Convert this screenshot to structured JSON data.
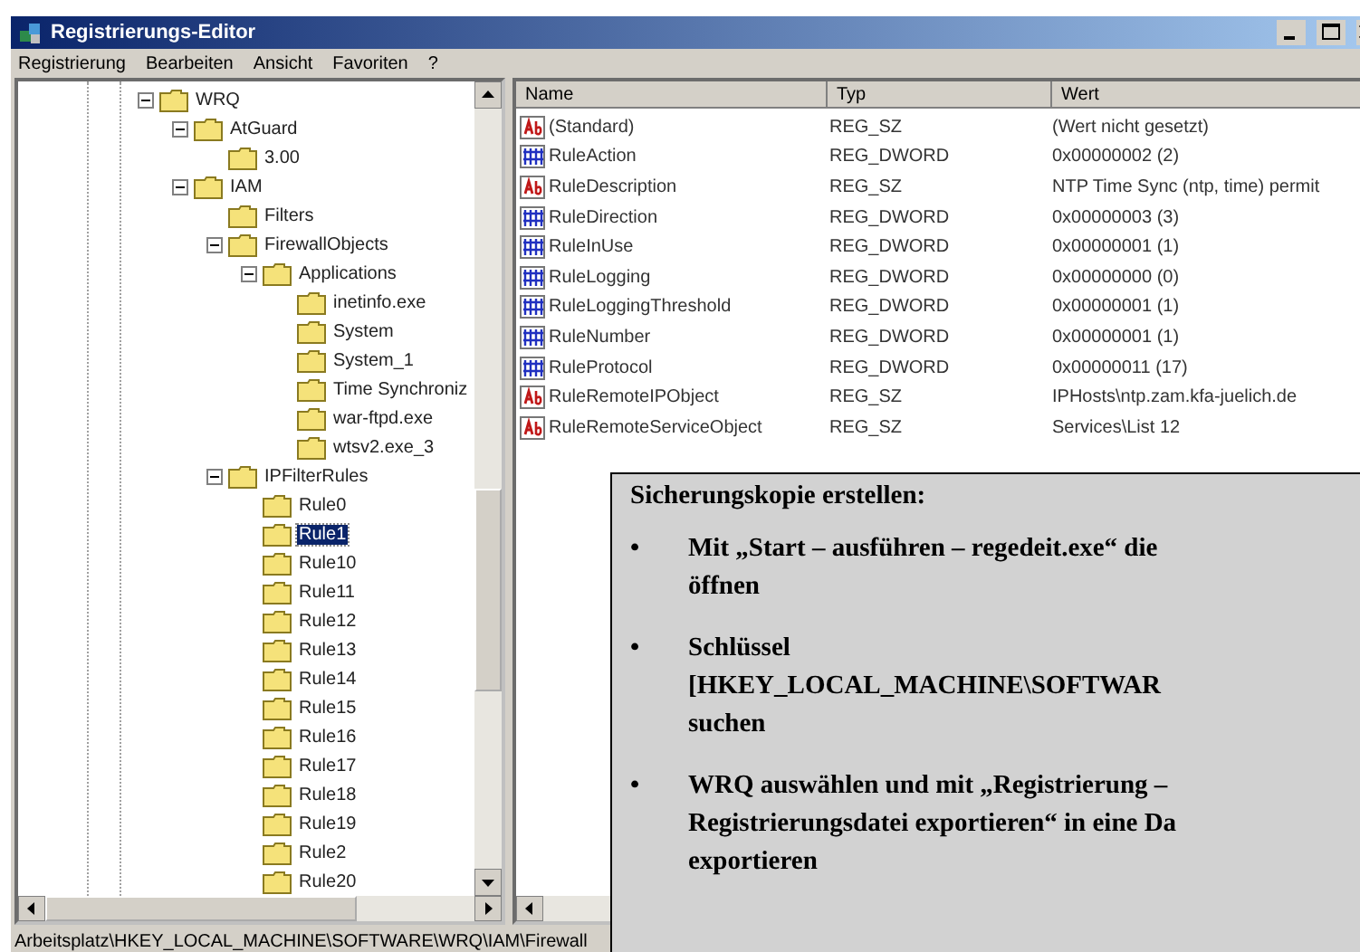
{
  "window": {
    "title": "Registrierungs-Editor"
  },
  "menu": [
    "Registrierung",
    "Bearbeiten",
    "Ansicht",
    "Favoriten",
    "?"
  ],
  "tree": [
    {
      "label": "WRQ",
      "expanded": true,
      "selected": false,
      "children": [
        {
          "label": "AtGuard",
          "expanded": true,
          "selected": false,
          "children": [
            {
              "label": "3.00",
              "selected": false
            }
          ]
        },
        {
          "label": "IAM",
          "expanded": true,
          "selected": false,
          "children": [
            {
              "label": "Filters",
              "selected": false
            },
            {
              "label": "FirewallObjects",
              "expanded": true,
              "selected": false,
              "children": [
                {
                  "label": "Applications",
                  "expanded": true,
                  "selected": false,
                  "children": [
                    {
                      "label": "inetinfo.exe",
                      "selected": false
                    },
                    {
                      "label": "System",
                      "selected": false
                    },
                    {
                      "label": "System_1",
                      "selected": false
                    },
                    {
                      "label": "Time Synchroniz",
                      "selected": false
                    },
                    {
                      "label": "war-ftpd.exe",
                      "selected": false
                    },
                    {
                      "label": "wtsv2.exe_3",
                      "selected": false
                    }
                  ]
                }
              ]
            },
            {
              "label": "IPFilterRules",
              "expanded": true,
              "selected": false,
              "children": [
                {
                  "label": "Rule0",
                  "selected": false
                },
                {
                  "label": "Rule1",
                  "selected": true
                },
                {
                  "label": "Rule10",
                  "selected": false
                },
                {
                  "label": "Rule11",
                  "selected": false
                },
                {
                  "label": "Rule12",
                  "selected": false
                },
                {
                  "label": "Rule13",
                  "selected": false
                },
                {
                  "label": "Rule14",
                  "selected": false
                },
                {
                  "label": "Rule15",
                  "selected": false
                },
                {
                  "label": "Rule16",
                  "selected": false
                },
                {
                  "label": "Rule17",
                  "selected": false
                },
                {
                  "label": "Rule18",
                  "selected": false
                },
                {
                  "label": "Rule19",
                  "selected": false
                },
                {
                  "label": "Rule2",
                  "selected": false
                },
                {
                  "label": "Rule20",
                  "selected": false
                }
              ]
            }
          ]
        }
      ]
    }
  ],
  "table": {
    "columns": [
      "Name",
      "Typ",
      "Wert"
    ],
    "rows": [
      {
        "kind": "string",
        "name": "(Standard)",
        "type": "REG_SZ",
        "value": "(Wert nicht gesetzt)"
      },
      {
        "kind": "number",
        "name": "RuleAction",
        "type": "REG_DWORD",
        "value": "0x00000002 (2)"
      },
      {
        "kind": "string",
        "name": "RuleDescription",
        "type": "REG_SZ",
        "value": "NTP Time Sync (ntp, time) permit"
      },
      {
        "kind": "number",
        "name": "RuleDirection",
        "type": "REG_DWORD",
        "value": "0x00000003 (3)"
      },
      {
        "kind": "number",
        "name": "RuleInUse",
        "type": "REG_DWORD",
        "value": "0x00000001 (1)"
      },
      {
        "kind": "number",
        "name": "RuleLogging",
        "type": "REG_DWORD",
        "value": "0x00000000 (0)"
      },
      {
        "kind": "number",
        "name": "RuleLoggingThreshold",
        "type": "REG_DWORD",
        "value": "0x00000001 (1)"
      },
      {
        "kind": "number",
        "name": "RuleNumber",
        "type": "REG_DWORD",
        "value": "0x00000001 (1)"
      },
      {
        "kind": "number",
        "name": "RuleProtocol",
        "type": "REG_DWORD",
        "value": "0x00000011 (17)"
      },
      {
        "kind": "string",
        "name": "RuleRemoteIPObject",
        "type": "REG_SZ",
        "value": "IPHosts\\ntp.zam.kfa-juelich.de"
      },
      {
        "kind": "string",
        "name": "RuleRemoteServiceObject",
        "type": "REG_SZ",
        "value": "Services\\List 12"
      }
    ]
  },
  "status_bar": "Arbeitsplatz\\HKEY_LOCAL_MACHINE\\SOFTWARE\\WRQ\\IAM\\Firewall",
  "note": {
    "title": "Sicherungskopie erstellen:",
    "bullets": [
      {
        "marker": "•",
        "lines": [
          "Mit „Start – ausführen – regedeit.exe“ die",
          "öffnen"
        ]
      },
      {
        "marker": "•",
        "lines": [
          "Schlüssel",
          "[HKEY_LOCAL_MACHINE\\SOFTWAR",
          "suchen"
        ]
      },
      {
        "marker": "•",
        "lines": [
          "WRQ auswählen und mit „Registrierung –",
          "Registrierungsdatei exportieren“ in eine Da",
          "exportieren"
        ]
      }
    ]
  }
}
